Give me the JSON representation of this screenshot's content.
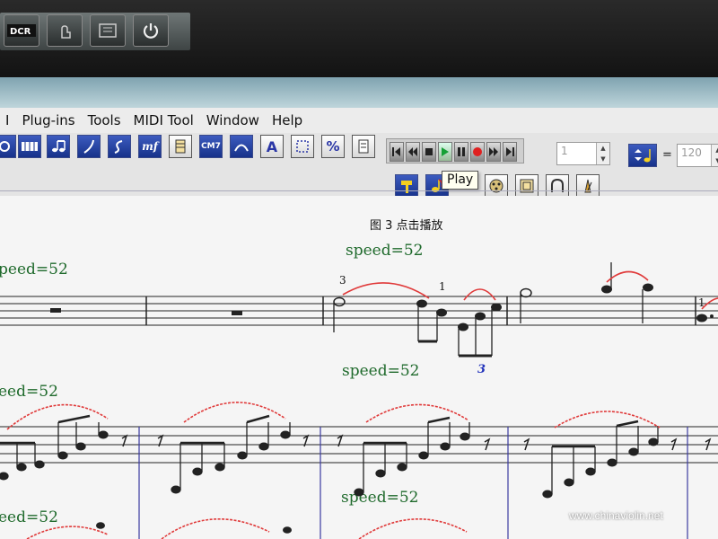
{
  "taskbar": {
    "buttons": [
      {
        "icon": "dcr-logo-icon"
      },
      {
        "icon": "touchpad-icon"
      },
      {
        "icon": "keyboard-icon"
      },
      {
        "icon": "power-icon"
      }
    ]
  },
  "menu": {
    "items": [
      {
        "label": "I"
      },
      {
        "label": "Plug-ins"
      },
      {
        "label": "Tools"
      },
      {
        "label": "MIDI Tool"
      },
      {
        "label": "Window"
      },
      {
        "label": "Help"
      }
    ]
  },
  "toolbar": {
    "chord_label": "CM7",
    "text_label": "A",
    "percent_label": "%",
    "dynamic_label": "mf"
  },
  "playback": {
    "measure_value": "1",
    "tempo_equals": "=",
    "tempo_value": "120",
    "tooltip": "Play"
  },
  "document": {
    "caption": "图 3  点击播放",
    "speed_labels": [
      "speed=52",
      "peed=52",
      "speed=52",
      "eed=52",
      "speed=52",
      "eed=52"
    ],
    "fingerings": [
      "3",
      "1",
      "1"
    ],
    "triplet": "3"
  },
  "watermark": "www.chinaviolin.net",
  "colors": {
    "speed_text": "#1f6a2c",
    "slur": "#e03a3a",
    "triplet": "#2233bb",
    "toolbar_icon_bg": "#17328a"
  }
}
